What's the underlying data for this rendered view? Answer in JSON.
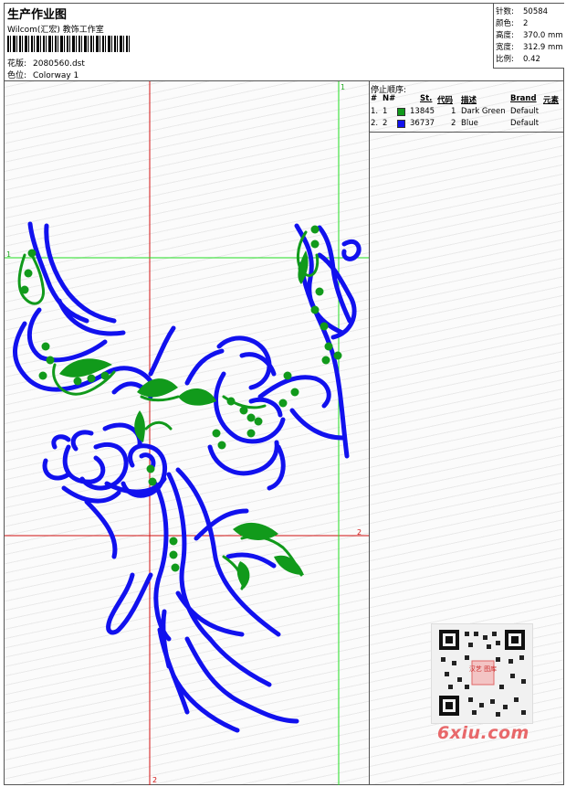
{
  "header": {
    "title": "生产作业图",
    "software": "Wilcom(汇宏) 教饰工作室",
    "design_label": "花版:",
    "design_file": "2080560.dst",
    "colorway_label": "色位:",
    "colorway": "Colorway 1"
  },
  "stats": [
    {
      "label": "针数:",
      "value": "50584"
    },
    {
      "label": "颜色:",
      "value": "2"
    },
    {
      "label": "高度:",
      "value": "370.0 mm"
    },
    {
      "label": "宽度:",
      "value": "312.9 mm"
    },
    {
      "label": "比例:",
      "value": "0.42"
    }
  ],
  "stop_sequence": {
    "title": "停止顺序:",
    "columns": {
      "hash": "#",
      "n": "N#",
      "st": "St.",
      "code": "代码",
      "desc": "描述",
      "brand": "Brand",
      "element": "元素"
    },
    "rows": [
      {
        "idx": "1.",
        "n": "1",
        "color": "#119a1b",
        "st": "13845",
        "code": "1",
        "desc": "Dark Green",
        "brand": "Default"
      },
      {
        "idx": "2.",
        "n": "2",
        "color": "#1111ee",
        "st": "36737",
        "code": "2",
        "desc": "Blue",
        "brand": "Default"
      }
    ]
  },
  "guides": {
    "mark_1": "1",
    "mark_2": "2"
  },
  "colors": {
    "green": "#119a1b",
    "blue": "#1111ee",
    "red_guide": "#d01010",
    "green_guide": "#22dd22"
  },
  "watermark": "6xiu.com",
  "qr_badge": "汉艺 图库"
}
